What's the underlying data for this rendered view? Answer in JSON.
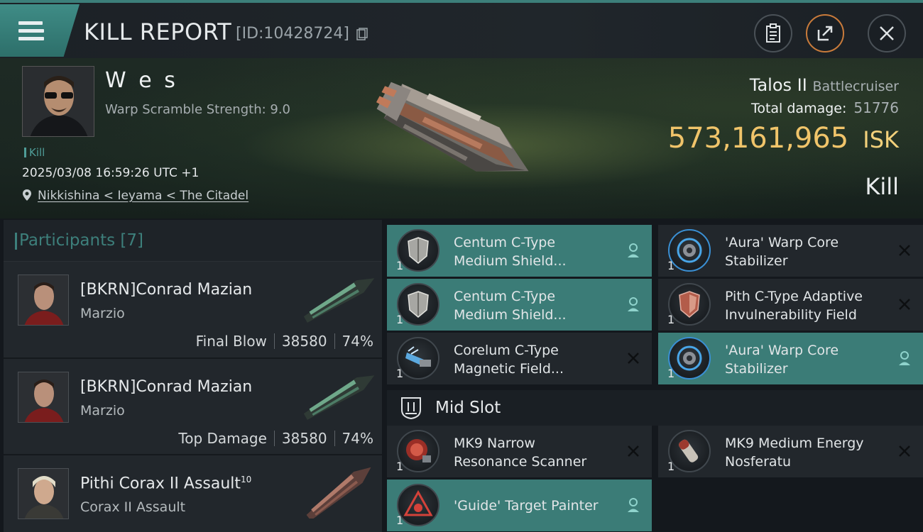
{
  "header": {
    "title": "KILL REPORT",
    "report_id": "[ID:10428724]"
  },
  "victim": {
    "name": "W e s",
    "warp_scramble": "Warp Scramble Strength: 9.0",
    "tag": "Kill",
    "datetime": "2025/03/08 16:59:26 UTC +1",
    "location": "Nikkishina < Ieyama < The Citadel",
    "ship_name": "Talos II",
    "ship_class": "Battlecruiser",
    "total_damage_label": "Total damage:",
    "total_damage": "51776",
    "isk_value": "573,161,965",
    "isk_unit": "ISK",
    "result": "Kill"
  },
  "participants": {
    "title": "Participants [7]",
    "items": [
      {
        "name": "[BKRN]Conrad Mazian",
        "ship": "Marzio",
        "role": "Final Blow",
        "damage": "38580",
        "percent": "74%"
      },
      {
        "name": "[BKRN]Conrad Mazian",
        "ship": "Marzio",
        "role": "Top Damage",
        "damage": "38580",
        "percent": "74%"
      },
      {
        "name": "Pithi Corax II Assault",
        "name_sup": "10",
        "ship": "Corax II Assault"
      }
    ]
  },
  "modules": {
    "items": [
      {
        "line1": "Centum C-Type",
        "line2": "Medium Shield...",
        "qty": "1",
        "status": "person"
      },
      {
        "line1": "'Aura' Warp Core",
        "line2": "Stabilizer",
        "qty": "1",
        "status": "destroyed"
      },
      {
        "line1": "Centum C-Type",
        "line2": "Medium Shield...",
        "qty": "1",
        "status": "person"
      },
      {
        "line1": "Pith C-Type Adaptive",
        "line2": "Invulnerability Field",
        "qty": "1",
        "status": "destroyed"
      },
      {
        "line1": "Corelum C-Type",
        "line2": "Magnetic Field...",
        "qty": "1",
        "status": "destroyed"
      },
      {
        "line1": "'Aura' Warp Core",
        "line2": "Stabilizer",
        "qty": "1",
        "status": "person"
      }
    ],
    "section_label": "Mid Slot",
    "mid_items": [
      {
        "line1": "MK9 Narrow",
        "line2": "Resonance Scanner",
        "qty": "1",
        "status": "destroyed"
      },
      {
        "line1": "MK9 Medium Energy",
        "line2": "Nosferatu",
        "qty": "1",
        "status": "destroyed"
      },
      {
        "line1": "'Guide' Target Painter",
        "qty": "1",
        "status": "person"
      }
    ]
  },
  "colors": {
    "accent": "#3b7c77",
    "isk": "#f0c46a",
    "header_accent": "#3f8c86"
  }
}
